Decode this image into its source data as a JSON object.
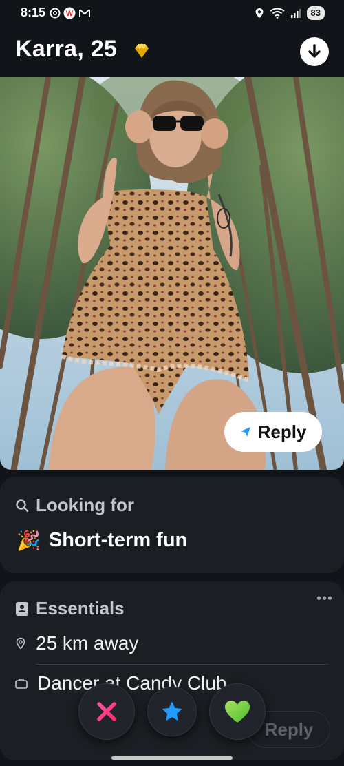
{
  "status_bar": {
    "time": "8:15",
    "battery": "83"
  },
  "profile": {
    "name_age": "Karra, 25"
  },
  "photo": {
    "reply_label": "Reply"
  },
  "looking_for": {
    "heading": "Looking for",
    "value": "Short-term fun",
    "emoji": "🎉"
  },
  "essentials": {
    "heading": "Essentials",
    "more": "•••",
    "distance": "25 km away",
    "job": "Dancer at Candy Club",
    "reply_label": "Reply"
  },
  "actions": {
    "nope_icon": "close-icon",
    "super_like_icon": "star-icon",
    "like_icon": "heart-icon"
  },
  "colors": {
    "background": "#111418",
    "card": "#1b1e23",
    "nope": "#ff3d7f",
    "super_like": "#1e9bff",
    "like": "#7ed321",
    "badge": "#f5c518"
  }
}
